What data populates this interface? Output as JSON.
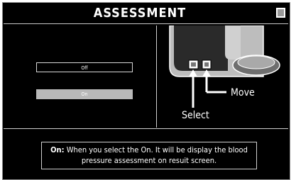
{
  "header": {
    "title": "ASSESSMENT"
  },
  "options": {
    "off_label": "Off",
    "on_label": "On",
    "selected": "On"
  },
  "device_illustration": {
    "select_label": "Select",
    "move_label": "Move"
  },
  "help": {
    "keyword": "On:",
    "text": "When you select the On. It will be display the blood pressure assessment on resuit screen."
  }
}
